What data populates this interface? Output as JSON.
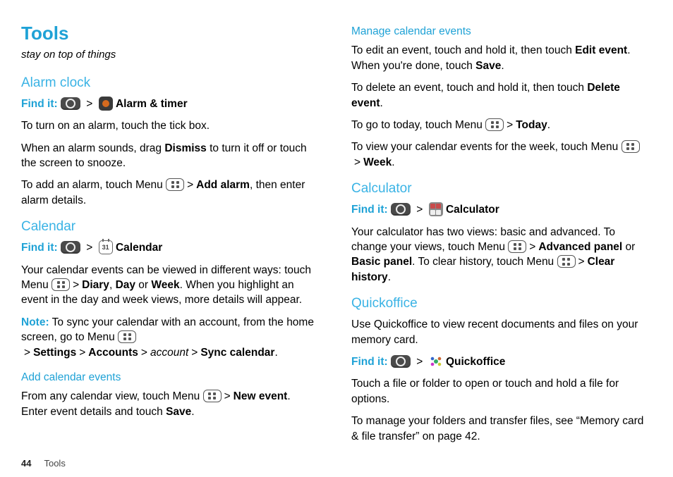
{
  "header": {
    "title": "Tools",
    "subtitle": "stay on top of things"
  },
  "alarm": {
    "heading": "Alarm clock",
    "findit": "Find it:",
    "appName": "Alarm & timer",
    "p1": "To turn on an alarm, touch the tick box.",
    "p2a": "When an alarm sounds, drag ",
    "p2b": "Dismiss",
    "p2c": " to turn it off or touch the screen to snooze.",
    "p3a": "To add an alarm, touch Menu ",
    "p3b": "Add alarm",
    "p3c": ", then enter alarm details."
  },
  "calendar": {
    "heading": "Calendar",
    "findit": "Find it:",
    "appName": "Calendar",
    "calDay": "31",
    "p1a": "Your calendar events can be viewed in different ways: touch Menu ",
    "p1b": "Diary",
    "p1c": ", ",
    "p1d": "Day",
    "p1e": " or ",
    "p1f": "Week",
    "p1g": ". When you highlight an event in the day and week views, more details will appear.",
    "noteWord": "Note:",
    "noteA": " To sync your calendar with an account, from the home screen, go to Menu ",
    "noteB": "Settings",
    "noteC": "Accounts",
    "noteD": "account",
    "noteE": "Sync calendar",
    "addHeading": "Add calendar events",
    "addA": "From any calendar view, touch Menu ",
    "addB": "New event",
    "addC": ". Enter event details and touch ",
    "addD": "Save",
    "addE": "."
  },
  "manage": {
    "heading": "Manage calendar events",
    "p1a": "To edit an event, touch and hold it, then touch ",
    "p1b": "Edit event",
    "p1c": ". When you're done, touch ",
    "p1d": "Save",
    "p1e": ".",
    "p2a": "To delete an event, touch and hold it, then touch ",
    "p2b": "Delete event",
    "p2c": ".",
    "p3a": "To go to today, touch Menu ",
    "p3b": "Today",
    "p3c": ".",
    "p4a": "To view your calendar events for the week, touch Menu ",
    "p4b": "Week",
    "p4c": "."
  },
  "calc": {
    "heading": "Calculator",
    "findit": "Find it:",
    "appName": "Calculator",
    "p1a": "Your calculator has two views: basic and advanced. To change your views, touch Menu ",
    "p1b": "Advanced panel",
    "p1c": " or ",
    "p1d": "Basic panel",
    "p1e": ". To clear history, touch Menu ",
    "p1f": "Clear history",
    "p1g": "."
  },
  "qo": {
    "heading": "Quickoffice",
    "p1": "Use Quickoffice to view recent documents and files on your memory card.",
    "findit": "Find it:",
    "appName": "Quickoffice",
    "p2": "Touch a file or folder to open or touch and hold a file for options.",
    "p3": "To manage your folders and transfer files, see “Memory card & file transfer” on page 42."
  },
  "footer": {
    "pageNum": "44",
    "section": "Tools"
  },
  "sep": ">"
}
